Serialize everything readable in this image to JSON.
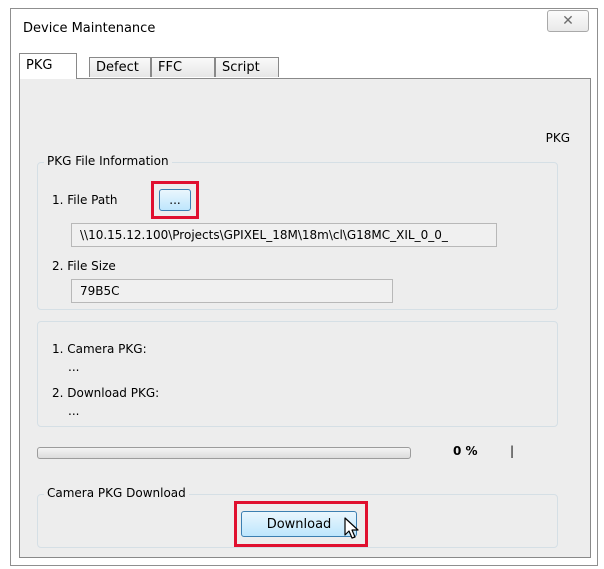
{
  "window": {
    "title": "Device Maintenance",
    "close_glyph": "✕"
  },
  "tabs": [
    {
      "label": "PKG",
      "active": true
    },
    {
      "label": "Defect",
      "active": false
    },
    {
      "label": "FFC",
      "active": false
    },
    {
      "label": "Script",
      "active": false
    }
  ],
  "pkg_panel": {
    "header_label": "PKG",
    "file_info": {
      "title": "PKG File Information",
      "file_path_label": "1. File Path",
      "browse_label": "...",
      "file_path_value": "\\\\10.15.12.100\\Projects\\GPIXEL_18M\\18m\\cl\\G18MC_XIL_0_0_",
      "file_size_label": "2. File Size",
      "file_size_value": "79B5C"
    },
    "versions": {
      "camera_pkg_label": "1. Camera PKG:",
      "camera_pkg_value": "...",
      "download_pkg_label": "2. Download PKG:",
      "download_pkg_value": "..."
    },
    "progress": {
      "percent_text": "0 %",
      "value": 0,
      "separator": "|"
    },
    "download_group": {
      "title": "Camera PKG Download",
      "download_label": "Download"
    }
  },
  "colors": {
    "highlight": "#e0102f",
    "panel_bg": "#ededed",
    "button_border": "#3c7fb1"
  },
  "icons": {
    "cursor": "mouse-pointer-icon",
    "close": "close-icon"
  }
}
